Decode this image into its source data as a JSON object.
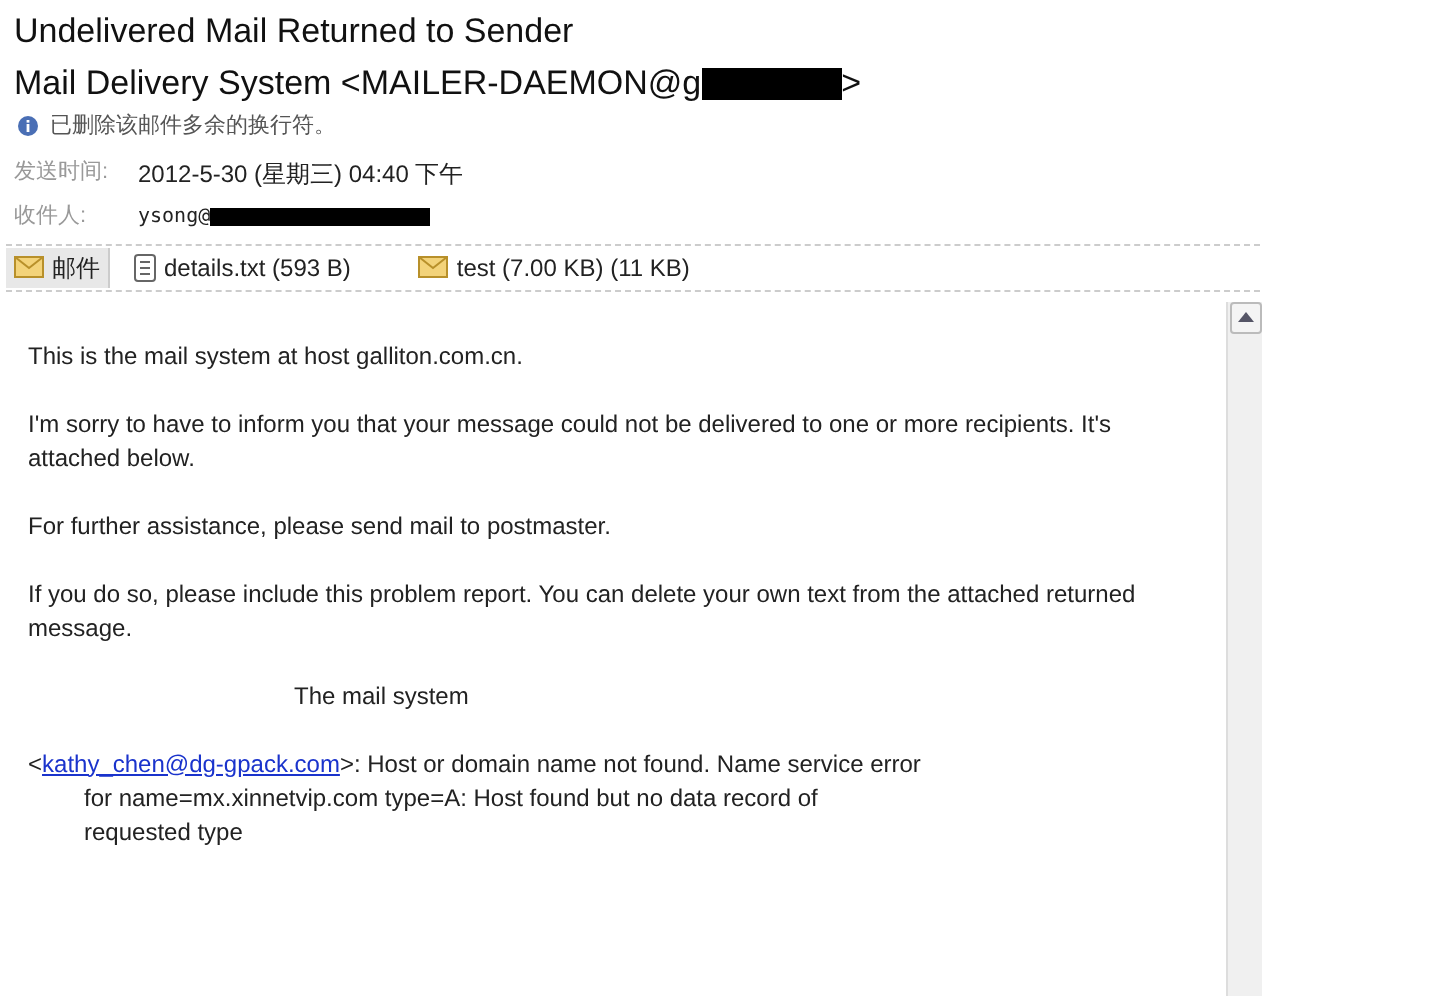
{
  "subject": "Undelivered Mail Returned to Sender",
  "sender": {
    "text": "Mail Delivery System <MAILER-DAEMON@g",
    "end": ">"
  },
  "notice": "已删除该邮件多余的换行符。",
  "fields": [
    {
      "label": "发送时间:",
      "value": "2012-5-30 (星期三) 04:40 下午",
      "redacted": false
    },
    {
      "label": "收件人:",
      "value": "ysong@",
      "redacted": true
    }
  ],
  "attachments": [
    {
      "kind": "mail",
      "label": "邮件",
      "selected": true
    },
    {
      "kind": "text",
      "label": "details.txt (593 B)",
      "selected": false
    },
    {
      "kind": "mail",
      "label": "test (7.00 KB) (11 KB)",
      "selected": false
    }
  ],
  "body": {
    "paragraphs": [
      "This is the mail system at host galliton.com.cn.",
      "I'm sorry to have to inform you that your message could not be delivered to one or more recipients. It's attached below.",
      "For further assistance, please send mail to postmaster.",
      "If you do so, please include this problem report. You can delete your own text from the attached returned message."
    ],
    "signature": "The mail system",
    "error": {
      "open": "<",
      "link": "kathy_chen@dg-gpack.com",
      "rest": ">: Host or domain name not found. Name service error",
      "continuation": [
        "for name=mx.xinnetvip.com type=A: Host found but no data record of",
        "requested type"
      ]
    }
  }
}
